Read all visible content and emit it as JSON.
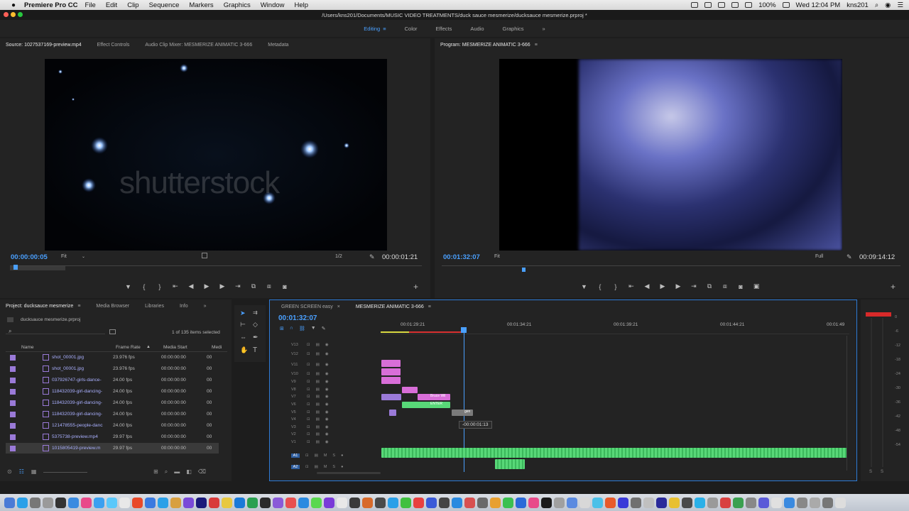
{
  "menubar": {
    "app": "Premiere Pro CC",
    "items": [
      "File",
      "Edit",
      "Clip",
      "Sequence",
      "Markers",
      "Graphics",
      "Window",
      "Help"
    ],
    "battery": "100%",
    "clock": "Wed 12:04 PM",
    "user": "kns201"
  },
  "titlebar": {
    "path": "/Users/kns201/Documents/MUSIC VIDEO TREATMENTS/duck sauce mesmerize/ducksauce mesmerize.prproj *"
  },
  "workspace": {
    "tabs": [
      "Editing",
      "Color",
      "Effects",
      "Audio",
      "Graphics"
    ],
    "active": "Editing",
    "more": "»"
  },
  "source": {
    "tabs": [
      "Source: 1027537169-preview.mp4",
      "Effect Controls",
      "Audio Clip Mixer: MESMERIZE ANIMATIC 3-666",
      "Metadata"
    ],
    "watermark": "shutterstock",
    "timecode": "00:00:00:05",
    "fit": "Fit",
    "resolution": "1/2",
    "duration": "00:00:01:21",
    "playhead_fraction": 0.008
  },
  "program": {
    "tab": "Program: MESMERIZE ANIMATIC 3-666",
    "timecode": "00:01:32:07",
    "fit": "Fit",
    "resolution": "Full",
    "duration": "00:09:14:12",
    "playhead_fraction": 0.16
  },
  "transport": {
    "marker": "▼",
    "in": "{",
    "out": "}",
    "go_in": "⇤",
    "step_back": "◀",
    "play": "▶",
    "step_fwd": "▶",
    "go_out": "⇥",
    "add": "+"
  },
  "project": {
    "tabs": [
      "Project: ducksauce mesmerize",
      "Media Browser",
      "Libraries",
      "Info"
    ],
    "more": "»",
    "file": "ducksauce mesmerize.prproj",
    "selection": "1 of 135 items selected",
    "columns": [
      "Name",
      "Frame Rate",
      "Media Start",
      "Medi"
    ],
    "rows": [
      {
        "name": "shot_00001.jpg",
        "fps": "23.976 fps",
        "start": "00:00:00:00",
        "extra": "00"
      },
      {
        "name": "shot_00001.jpg",
        "fps": "23.976 fps",
        "start": "00:00:00:00",
        "extra": "00"
      },
      {
        "name": "037926747-girls-dance-",
        "fps": "24.00 fps",
        "start": "00:00:00:00",
        "extra": "00"
      },
      {
        "name": "118432039-girl-dancing-",
        "fps": "24.00 fps",
        "start": "00:00:00:00",
        "extra": "00"
      },
      {
        "name": "118432039-girl-dancing-",
        "fps": "24.00 fps",
        "start": "00:00:00:00",
        "extra": "00"
      },
      {
        "name": "118432039-girl-dancing-",
        "fps": "24.00 fps",
        "start": "00:00:00:00",
        "extra": "00"
      },
      {
        "name": "121478555-people-danc",
        "fps": "24.00 fps",
        "start": "00:00:00:00",
        "extra": "00"
      },
      {
        "name": "5375738-preview.mp4",
        "fps": "29.97 fps",
        "start": "00:00:00:00",
        "extra": "00"
      },
      {
        "name": "1015805419-preview.m",
        "fps": "29.97 fps",
        "start": "00:00:00:00",
        "extra": "00"
      }
    ]
  },
  "timeline": {
    "tabs": [
      "GREEN SCREEN easy",
      "MESMERIZE ANIMATIC 3-666"
    ],
    "timecode": "00:01:32:07",
    "ruler": [
      "00:01:29:21",
      "00:01:34:21",
      "00:01:39:21",
      "00:01:44:21",
      "00:01:49"
    ],
    "video_tracks": [
      "V13",
      "V12",
      "V11",
      "V10",
      "V9",
      "V8",
      "V7",
      "V6",
      "V5",
      "V4",
      "V3",
      "V2",
      "V1"
    ],
    "audio_tracks": [
      "A1",
      "A2"
    ],
    "clip_labels": {
      "bruce": "Bruce Wil",
      "enter": "ENTER",
      "gen": "gen"
    },
    "tooltip": "-00:00:01:13",
    "meter_labels": [
      "0",
      "-6",
      "-12",
      "-18",
      "-24",
      "-30",
      "-36",
      "-42",
      "-48",
      "-54"
    ]
  },
  "colors": {
    "accent": "#4aa0ff",
    "pink": "#d86ed8",
    "green": "#58d878",
    "purple": "#9a7ad8"
  }
}
